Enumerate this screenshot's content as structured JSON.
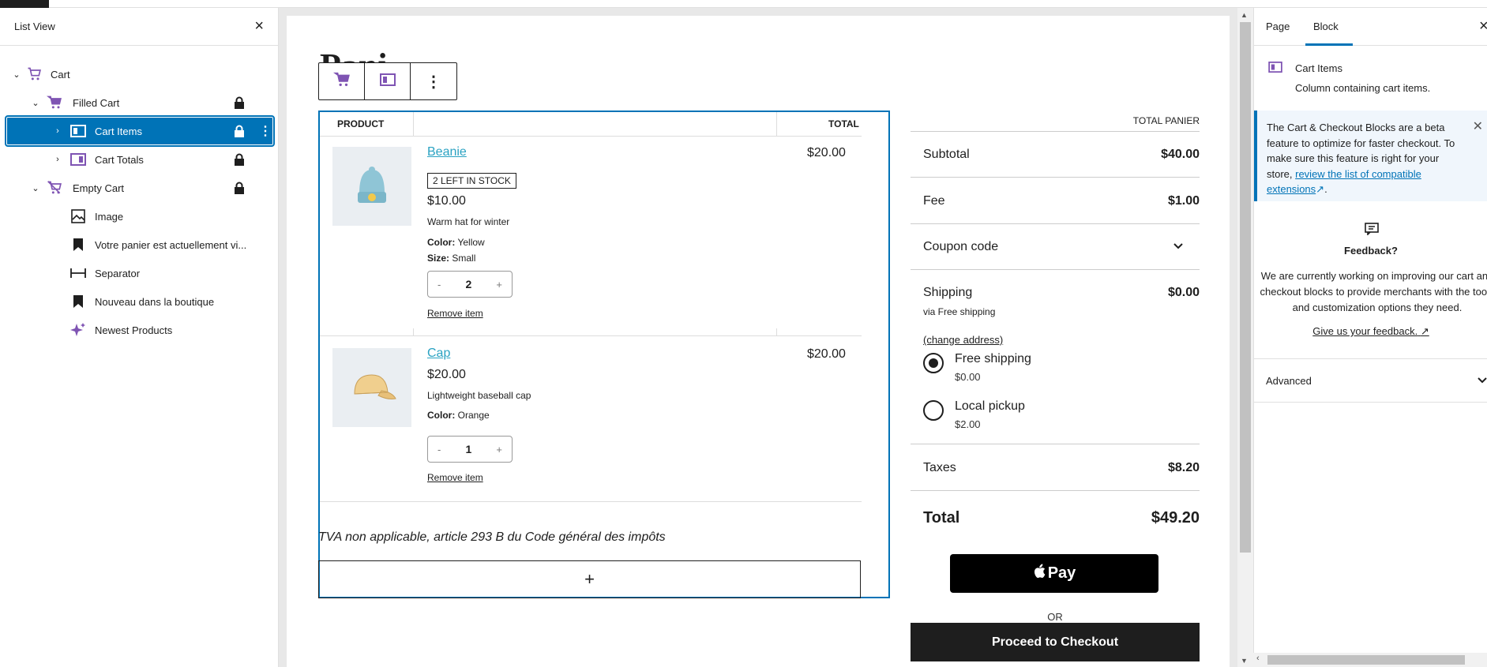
{
  "list_view": {
    "title": "List View",
    "items": [
      {
        "label": "Cart"
      },
      {
        "label": "Filled Cart"
      },
      {
        "label": "Cart Items"
      },
      {
        "label": "Cart Totals"
      },
      {
        "label": "Empty Cart"
      },
      {
        "label": "Image"
      },
      {
        "label": "Votre panier est actuellement vi..."
      },
      {
        "label": "Separator"
      },
      {
        "label": "Nouveau dans la boutique"
      },
      {
        "label": "Newest Products"
      }
    ]
  },
  "page": {
    "title": "Pani"
  },
  "cart": {
    "headers": {
      "product": "PRODUCT",
      "total": "TOTAL"
    },
    "items": [
      {
        "name": "Beanie",
        "stock": "2 LEFT IN STOCK",
        "price": "$10.00",
        "description": "Warm hat for winter",
        "attributes": [
          {
            "key": "Color:",
            "value": "Yellow"
          },
          {
            "key": "Size:",
            "value": "Small"
          }
        ],
        "quantity": "2",
        "remove": "Remove item",
        "total": "$20.00"
      },
      {
        "name": "Cap",
        "price": "$20.00",
        "description": "Lightweight baseball cap",
        "attributes": [
          {
            "key": "Color:",
            "value": "Orange"
          }
        ],
        "quantity": "1",
        "remove": "Remove item",
        "total": "$20.00"
      }
    ],
    "qty_minus": "-",
    "qty_plus": "+",
    "tva_note": "TVA non applicable, article 293 B du Code général des impôts",
    "appender": "+"
  },
  "totals": {
    "header": "TOTAL PANIER",
    "subtotal": {
      "label": "Subtotal",
      "value": "$40.00"
    },
    "fee": {
      "label": "Fee",
      "value": "$1.00"
    },
    "coupon": {
      "label": "Coupon code"
    },
    "shipping": {
      "label": "Shipping",
      "value": "$0.00",
      "via": "via Free shipping",
      "change": "(change address)"
    },
    "options": [
      {
        "label": "Free shipping",
        "price": "$0.00",
        "selected": true
      },
      {
        "label": "Local pickup",
        "price": "$2.00",
        "selected": false
      }
    ],
    "taxes": {
      "label": "Taxes",
      "value": "$8.20"
    },
    "total": {
      "label": "Total",
      "value": "$49.20"
    },
    "apple_pay": "Pay",
    "or": "OR",
    "checkout": "Proceed to Checkout"
  },
  "inspector": {
    "tabs": [
      "Page",
      "Block"
    ],
    "block_name": "Cart Items",
    "block_desc": "Column containing cart items.",
    "notice_text": "The Cart & Checkout Blocks are a beta feature to optimize for faster checkout. To make sure this feature is right for your store, ",
    "notice_link": "review the list of compatible extensions",
    "notice_end": ".",
    "feedback_title": "Feedback?",
    "feedback_text_1": "We are currently working on improving our cart and",
    "feedback_text_2": "checkout blocks to provide merchants with the tools",
    "feedback_text_3": "and customization options they need.",
    "feedback_link": "Give us your feedback.",
    "advanced": "Advanced"
  },
  "colors": {
    "accent": "#0073b7",
    "icon_purple": "#7f54b3",
    "link": "#2aa2c2"
  }
}
